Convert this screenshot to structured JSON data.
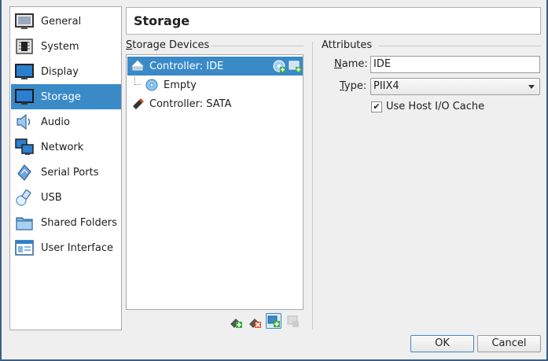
{
  "sidebar": {
    "items": [
      {
        "label": "General",
        "icon": "general-icon"
      },
      {
        "label": "System",
        "icon": "system-icon"
      },
      {
        "label": "Display",
        "icon": "display-icon"
      },
      {
        "label": "Storage",
        "icon": "storage-icon",
        "selected": true
      },
      {
        "label": "Audio",
        "icon": "audio-icon"
      },
      {
        "label": "Network",
        "icon": "network-icon"
      },
      {
        "label": "Serial Ports",
        "icon": "serial-ports-icon"
      },
      {
        "label": "USB",
        "icon": "usb-icon"
      },
      {
        "label": "Shared Folders",
        "icon": "shared-folders-icon"
      },
      {
        "label": "User Interface",
        "icon": "user-interface-icon"
      }
    ]
  },
  "page_title": "Storage",
  "storage_devices": {
    "title": "Storage Devices",
    "title_mnemonic": "S",
    "title_rest": "torage Devices",
    "tree": [
      {
        "label": "Controller: IDE",
        "icon": "ide-controller-icon",
        "selected": true
      },
      {
        "label": "Empty",
        "icon": "optical-disc-icon"
      },
      {
        "label": "Controller: SATA",
        "icon": "sata-controller-icon"
      }
    ]
  },
  "attributes": {
    "title": "Attributes",
    "name_label_mn": "N",
    "name_label_rest": "ame:",
    "name_value": "IDE",
    "type_label_mn": "T",
    "type_label_rest": "ype:",
    "type_value": "PIIX4",
    "host_cache_mn": "",
    "host_cache_label": "Use Host I/O Cache",
    "host_cache_checked": "✔"
  },
  "buttons": {
    "ok": "OK",
    "cancel": "Cancel"
  },
  "colors": {
    "selection": "#3a8ac8",
    "frame": "#3b5f86"
  }
}
